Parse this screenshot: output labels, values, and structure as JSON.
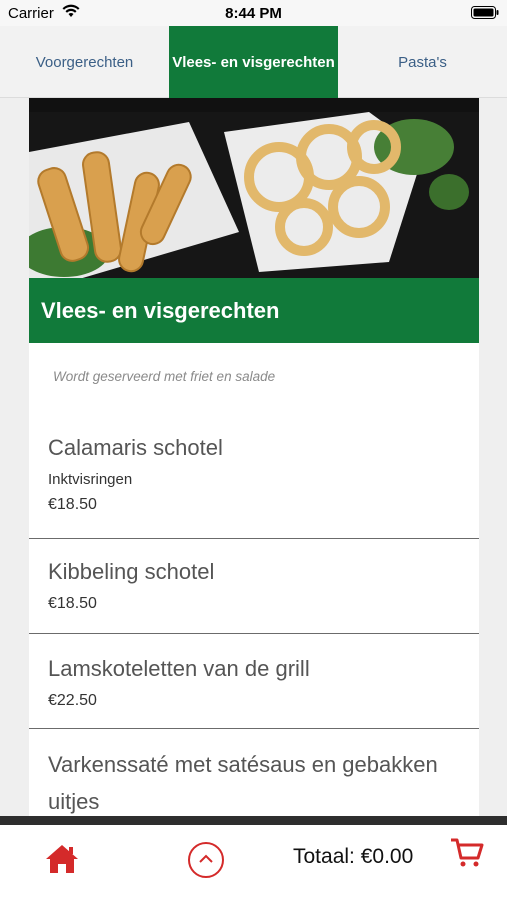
{
  "status_bar": {
    "carrier": "Carrier",
    "time": "8:44 PM"
  },
  "tabs": [
    {
      "label": "Voorgerechten",
      "active": false
    },
    {
      "label": "Vlees- en visgerechten",
      "active": true
    },
    {
      "label": "Pasta's",
      "active": false
    }
  ],
  "section": {
    "title": "Vlees- en visgerechten",
    "subtitle": "Wordt geserveerd met friet en salade"
  },
  "items": [
    {
      "name": "Calamaris schotel",
      "description": "Inktvisringen",
      "price": "€18.50"
    },
    {
      "name": "Kibbeling schotel",
      "price": "€18.50"
    },
    {
      "name": "Lamskoteletten van de grill",
      "price": "€22.50"
    },
    {
      "name": "Varkenssaté met satésaus en gebakken uitjes"
    }
  ],
  "footer": {
    "total": "Totaal: €0.00"
  },
  "colors": {
    "brand_green": "#117a3a",
    "accent_red": "#d42a2a",
    "tab_text": "#3b5f86"
  },
  "icons": {
    "home": "home-icon",
    "scroll_up": "chevron-up-icon",
    "cart": "cart-icon"
  }
}
